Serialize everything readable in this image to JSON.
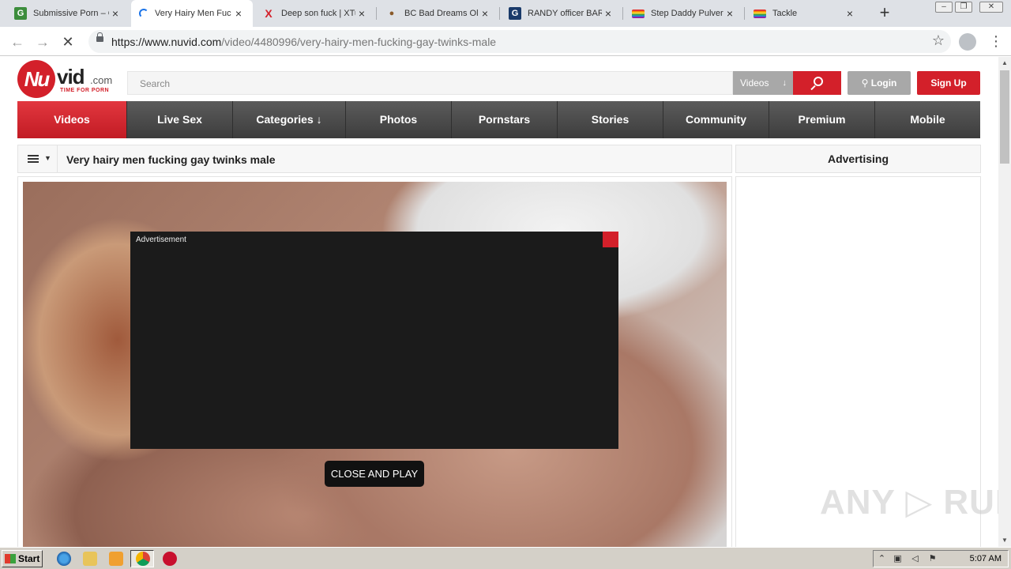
{
  "browser": {
    "tabs": [
      {
        "title": "Submissive Porn – G",
        "favicon": "G",
        "color": "#3c8d3c"
      },
      {
        "title": "Very Hairy Men Fuc",
        "favicon": "loading",
        "color": "#1a73e8"
      },
      {
        "title": "Deep son fuck | XTu",
        "favicon": "X",
        "color": "#d3202a"
      },
      {
        "title": "BC Bad Dreams Oli",
        "favicon": "●",
        "color": "#8a5a2a"
      },
      {
        "title": "RANDY officer BAR",
        "favicon": "G",
        "color": "#1a3a6a"
      },
      {
        "title": "Step Daddy Pulver",
        "favicon": "rainbow",
        "color": "#e67e22"
      },
      {
        "title": "Tackle",
        "favicon": "rainbow",
        "color": "#e67e22"
      }
    ],
    "url_host": "https://www.nuvid.com",
    "url_path": "/video/4480996/very-hairy-men-fucking-gay-twinks-male"
  },
  "site": {
    "logo_main": "Nu",
    "logo_word": "vid",
    "logo_dotcom": ".com",
    "logo_tagline": "TIME FOR PORN",
    "search_placeholder": "Search",
    "search_scope": "Videos",
    "login_label": "Login",
    "signup_label": "Sign Up",
    "nav": [
      {
        "label": "Videos",
        "active": true
      },
      {
        "label": "Live Sex",
        "active": false
      },
      {
        "label": "Categories ↓",
        "active": false
      },
      {
        "label": "Photos",
        "active": false
      },
      {
        "label": "Pornstars",
        "active": false
      },
      {
        "label": "Stories",
        "active": false
      },
      {
        "label": "Community",
        "active": false
      },
      {
        "label": "Premium",
        "active": false
      },
      {
        "label": "Mobile",
        "active": false
      }
    ],
    "video_title": "Very hairy men fucking gay twinks male",
    "advertising_heading": "Advertising",
    "ad_label": "Advertisement",
    "close_play_label": "CLOSE AND PLAY",
    "watermark": "ANY ▷ RUN"
  },
  "taskbar": {
    "start_label": "Start",
    "clock": "5:07 AM"
  }
}
